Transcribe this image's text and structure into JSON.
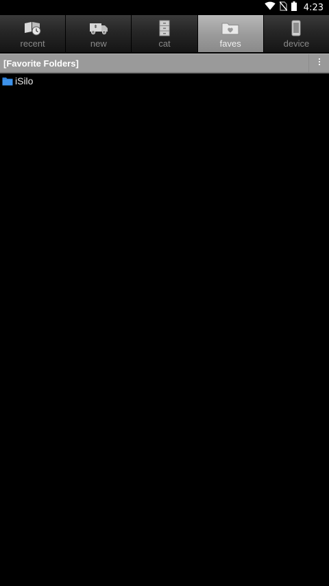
{
  "status_bar": {
    "time": "4:23",
    "icons": [
      "wifi-icon",
      "no-sim-icon",
      "battery-icon"
    ]
  },
  "tabs": [
    {
      "label": "recent",
      "icon": "recent-books-clock-icon",
      "active": false
    },
    {
      "label": "new",
      "icon": "delivery-truck-icon",
      "active": false
    },
    {
      "label": "cat",
      "icon": "file-cabinet-icon",
      "active": false
    },
    {
      "label": "faves",
      "icon": "folder-heart-icon",
      "active": true
    },
    {
      "label": "device",
      "icon": "phone-device-icon",
      "active": false
    }
  ],
  "folder_header": {
    "title": "[Favorite Folders]",
    "menu_icon": "overflow-menu-icon"
  },
  "folders": [
    {
      "name": "iSilo",
      "icon": "folder-icon",
      "icon_color": "#2f7fd6"
    }
  ]
}
